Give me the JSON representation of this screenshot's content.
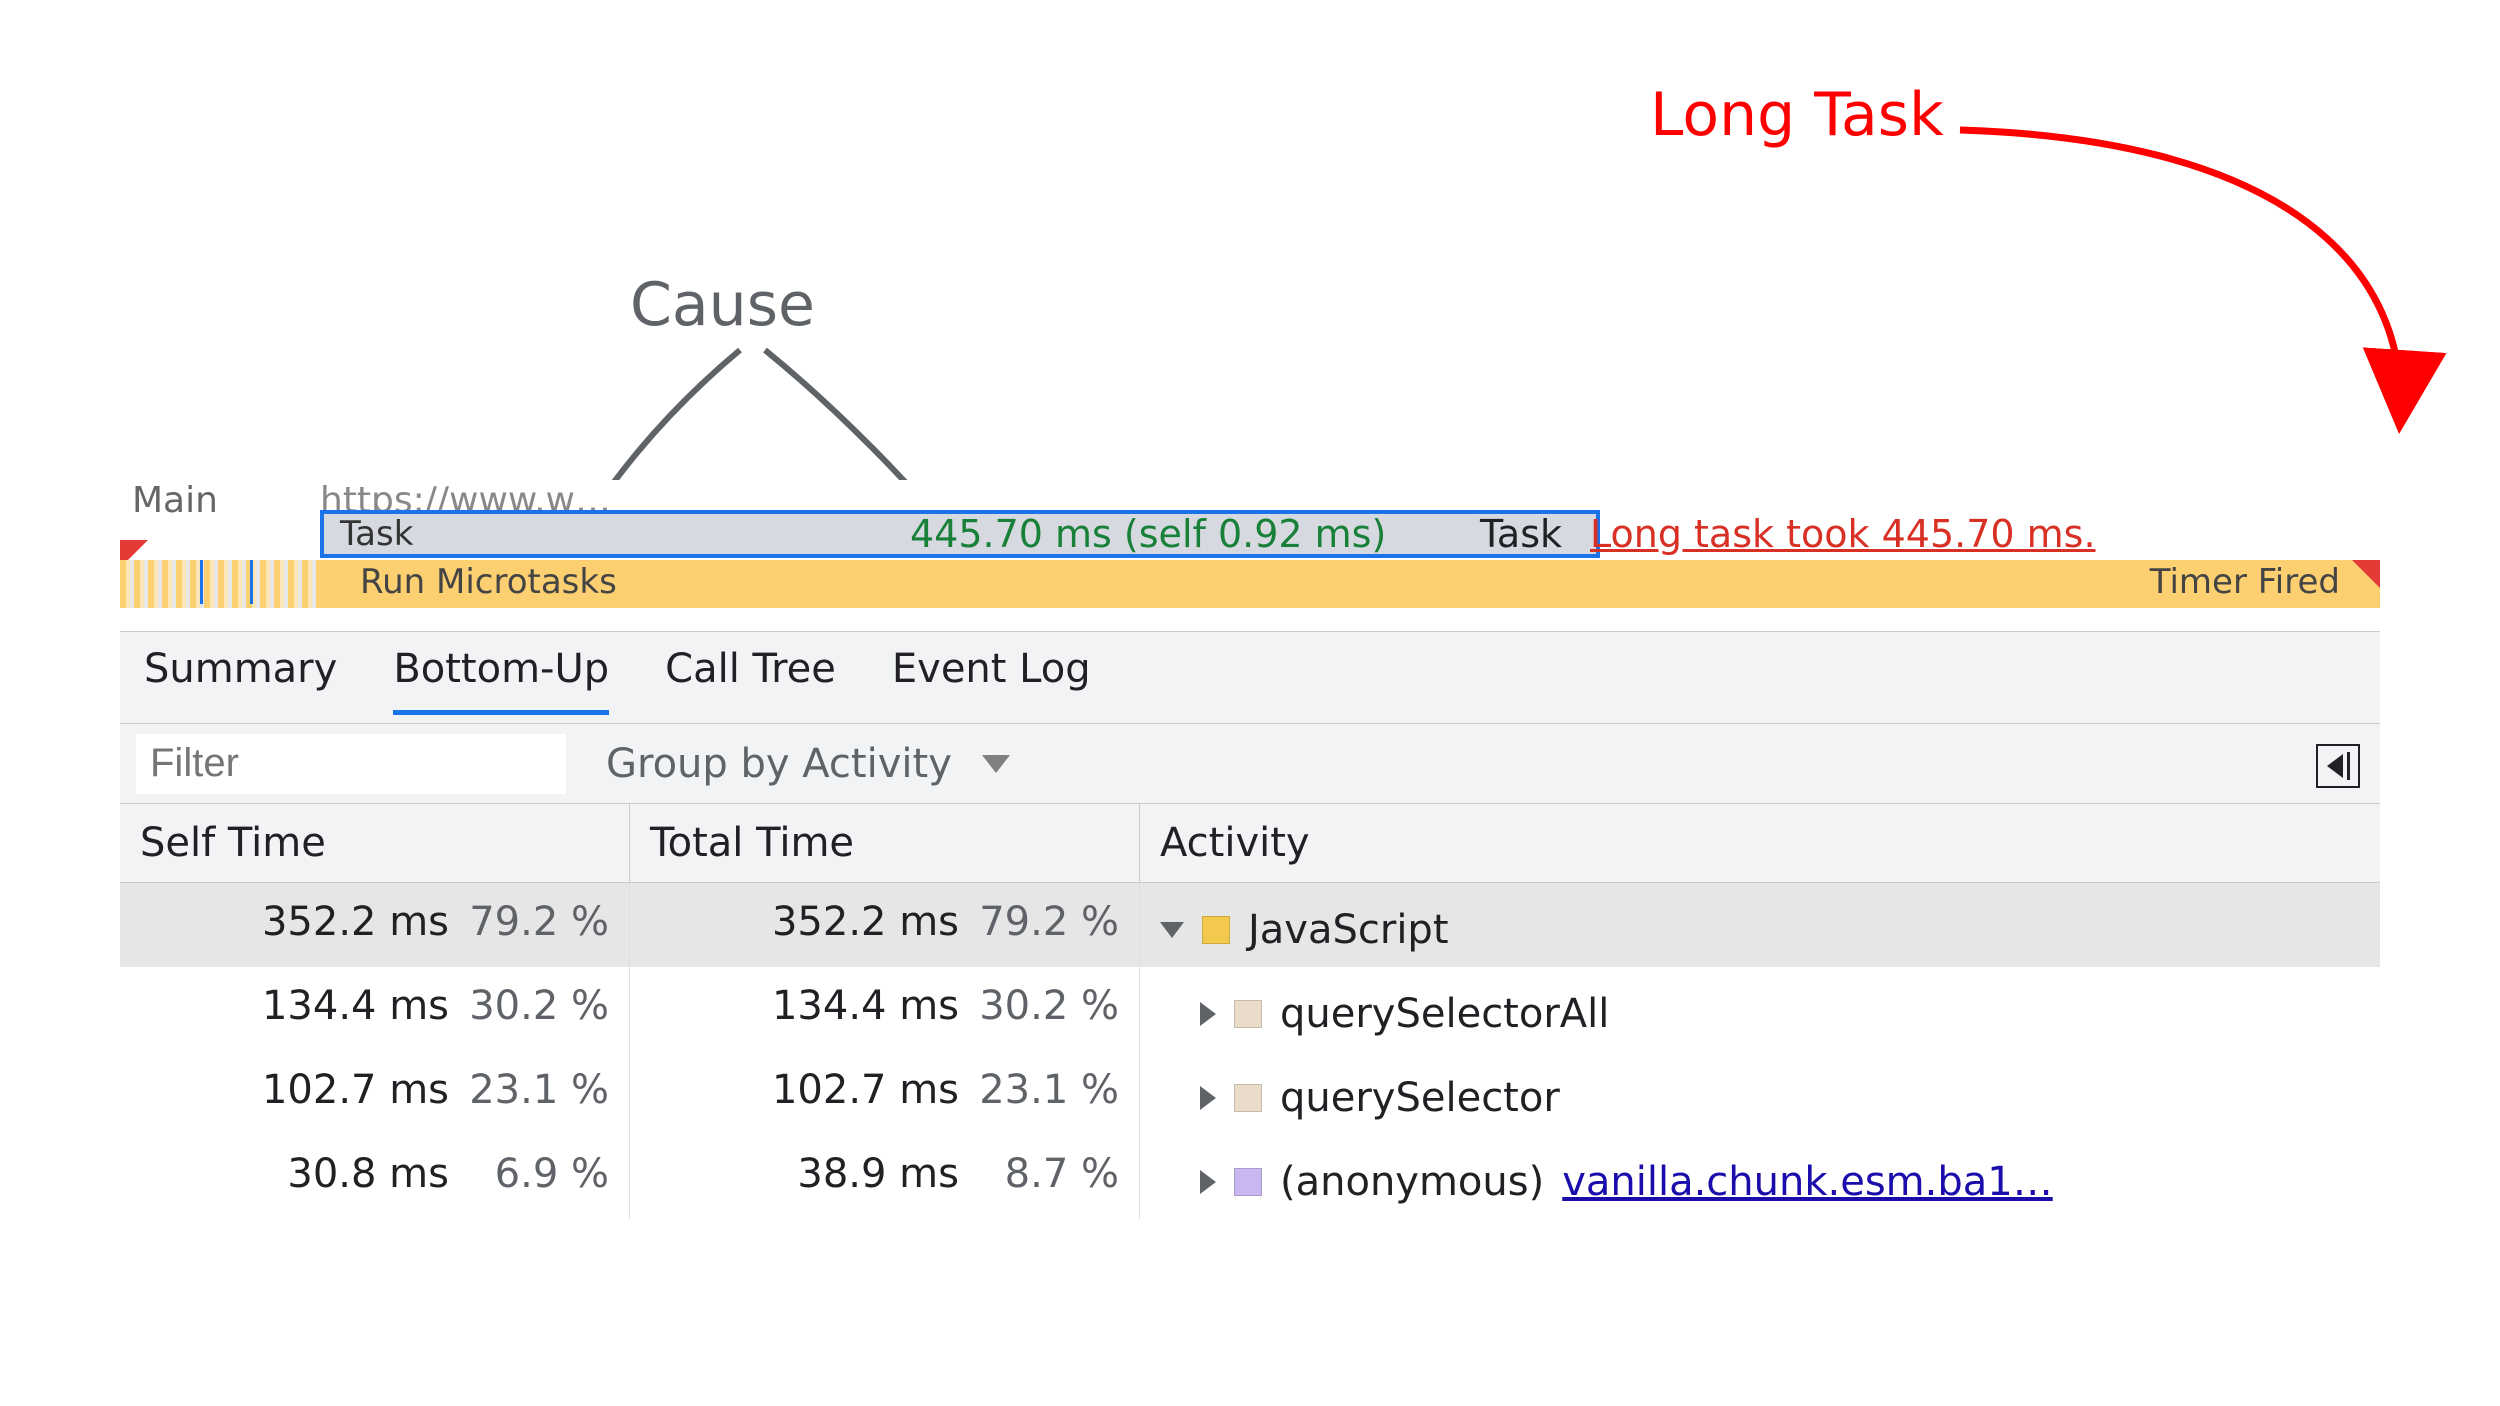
{
  "annotations": {
    "long_task": "Long Task",
    "cause": "Cause"
  },
  "flame": {
    "main_label": "Main",
    "url_fragment": "https://www.w…",
    "task_label": "Task",
    "duration_text": "445.70 ms (self 0.92 ms)",
    "type_label": "Task",
    "warning_text": "Long task took 445.70 ms.",
    "microtasks_label": "Run Microtasks",
    "timer_label": "Timer Fired"
  },
  "tabs": {
    "summary": "Summary",
    "bottom_up": "Bottom-Up",
    "call_tree": "Call Tree",
    "event_log": "Event Log",
    "active": "bottom_up"
  },
  "filter": {
    "placeholder": "Filter",
    "group_label": "Group by Activity"
  },
  "columns": {
    "self": "Self Time",
    "total": "Total Time",
    "activity": "Activity"
  },
  "rows": [
    {
      "self_time": "352.2 ms",
      "self_pct": "79.2 %",
      "self_pct_bar": 79.2,
      "total_time": "352.2 ms",
      "total_pct": "79.2 %",
      "total_pct_bar": 79.2,
      "activity": "JavaScript",
      "swatch": "sw-js",
      "expanded": true,
      "selected": true
    },
    {
      "self_time": "134.4 ms",
      "self_pct": "30.2 %",
      "self_pct_bar": 30.2,
      "total_time": "134.4 ms",
      "total_pct": "30.2 %",
      "total_pct_bar": 30.2,
      "activity": "querySelectorAll",
      "swatch": "sw-dom",
      "indent": 1
    },
    {
      "self_time": "102.7 ms",
      "self_pct": "23.1 %",
      "self_pct_bar": 23.1,
      "total_time": "102.7 ms",
      "total_pct": "23.1 %",
      "total_pct_bar": 23.1,
      "activity": "querySelector",
      "swatch": "sw-dom",
      "indent": 1
    },
    {
      "self_time": "30.8 ms",
      "self_pct": "6.9 %",
      "self_pct_bar": 6.9,
      "total_time": "38.9 ms",
      "total_pct": "8.7 %",
      "total_pct_bar": 8.7,
      "activity": "(anonymous)",
      "swatch": "sw-anon",
      "link": "vanilla.chunk.esm.ba1…",
      "indent": 1
    }
  ]
}
